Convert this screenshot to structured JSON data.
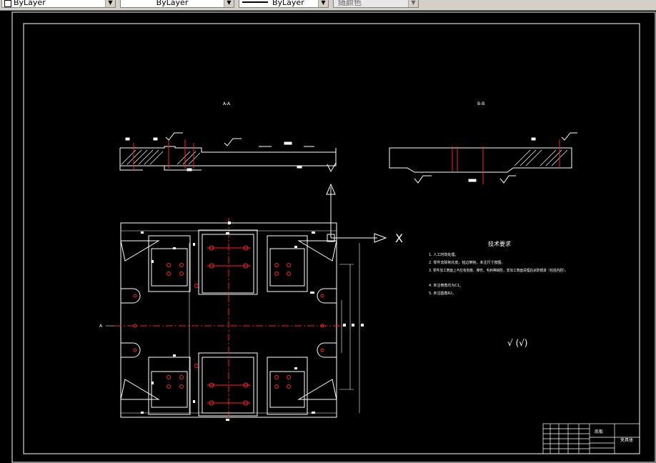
{
  "toolbar": {
    "layer_combo": "ByLayer",
    "linetype_combo": "ByLayer",
    "lineweight_combo": "ByLayer",
    "plotstyle_combo": "随颜色"
  },
  "drawing": {
    "section_a_label": "A-A",
    "section_b_label": "B-B",
    "axis_x_label": "X",
    "view_arrow_label": "A",
    "tech_title": "技术要求",
    "tech_lines": [
      "1. 人工时效处理。",
      "2. 零件去除氧化皮，锐边倒钝，未注尺寸按图。",
      "3. 零件加工表面上不应有划痕、擦伤、毛刺等缺陷，非加工表面清理后涂防锈漆（包括内腔）。",
      "4. 未注倒角均为C1。",
      "5. 未注圆角R2。"
    ],
    "roughness_note": "√ (√)",
    "title_block_name": "底板",
    "title_block_code": "夹具体"
  },
  "colors": {
    "background": "#000000",
    "lines": "#ffffff",
    "centerlines": "#ff2020",
    "toolbar": "#d4d0c8"
  }
}
